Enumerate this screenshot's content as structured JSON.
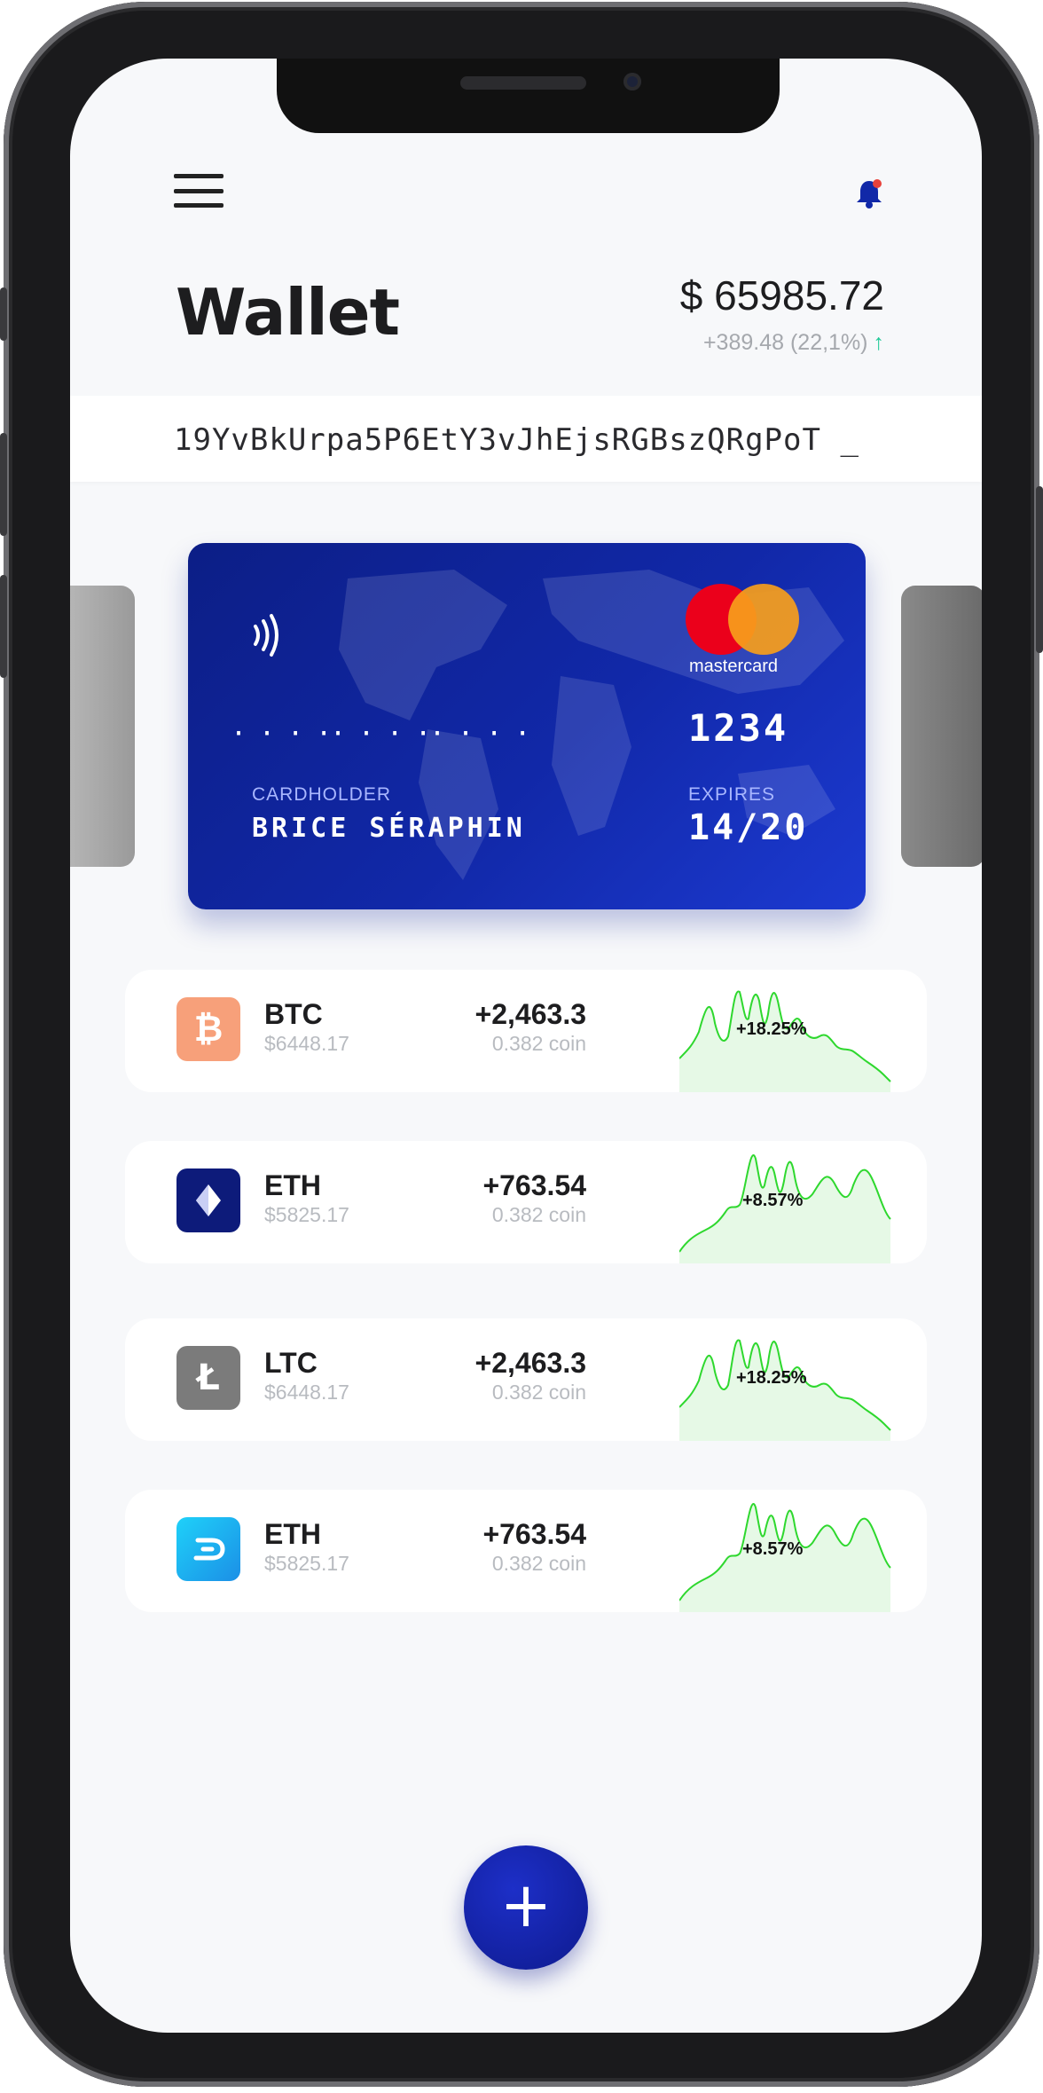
{
  "header": {
    "title": "Wallet",
    "balance": "$ 65985.72",
    "change": "+389.48 (22,1%)",
    "change_arrow": "↑"
  },
  "address": "19YvBkUrpa5P6EtY3vJhEjsRGBszQRgPoT _",
  "card": {
    "brand": "mastercard",
    "masked_groups": [
      "····",
      "····",
      "····"
    ],
    "last4": "1234",
    "cardholder_label": "CARDHOLDER",
    "cardholder": "BRICE SÉRAPHIN",
    "expires_label": "EXPIRES",
    "expires": "14/20"
  },
  "assets": [
    {
      "symbol": "BTC",
      "price": "$6448.17",
      "amount": "+2,463.3",
      "coins": "0.382 coin",
      "percent": "+18.25%",
      "icon": "bitcoin-icon",
      "icon_color": "#f7a07a"
    },
    {
      "symbol": "ETH",
      "price": "$5825.17",
      "amount": "+763.54",
      "coins": "0.382 coin",
      "percent": "+8.57%",
      "icon": "ethereum-icon",
      "icon_color": "#0d1b7a"
    },
    {
      "symbol": "LTC",
      "price": "$6448.17",
      "amount": "+2,463.3",
      "coins": "0.382 coin",
      "percent": "+18.25%",
      "icon": "litecoin-icon",
      "icon_color": "#7b7b7b"
    },
    {
      "symbol": "ETH",
      "price": "$5825.17",
      "amount": "+763.54",
      "coins": "0.382 coin",
      "percent": "+8.57%",
      "icon": "dash-icon",
      "icon_color": "#1ab8f0"
    }
  ],
  "fab": {
    "label": "+"
  },
  "colors": {
    "accent": "#1128a8",
    "positive": "#20c997",
    "spark_line": "#2ed82e",
    "notification": "#e8413a"
  }
}
